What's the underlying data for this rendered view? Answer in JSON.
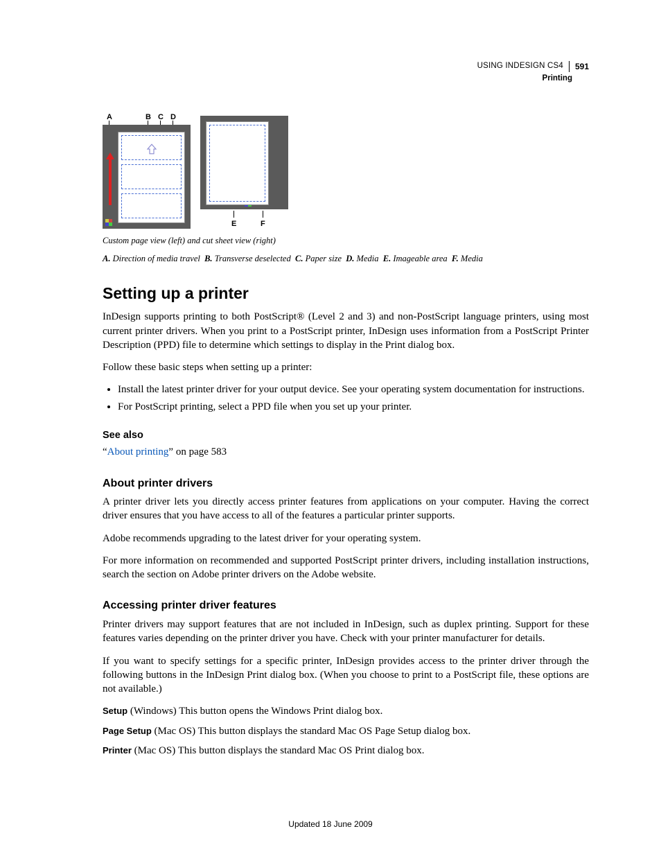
{
  "header": {
    "title": "USING INDESIGN CS4",
    "section": "Printing",
    "page": "591"
  },
  "figure": {
    "top_labels": {
      "A": "A",
      "B": "B",
      "C": "C",
      "D": "D"
    },
    "bottom_labels": {
      "E": "E",
      "F": "F"
    },
    "caption_title": "Custom page view (left) and cut sheet view (right)",
    "key": {
      "A": {
        "letter": "A.",
        "text": "Direction of media travel"
      },
      "B": {
        "letter": "B.",
        "text": "Transverse deselected"
      },
      "C": {
        "letter": "C.",
        "text": "Paper size"
      },
      "D": {
        "letter": "D.",
        "text": "Media"
      },
      "E": {
        "letter": "E.",
        "text": "Imageable area"
      },
      "F": {
        "letter": "F.",
        "text": "Media"
      }
    }
  },
  "h1": "Setting up a printer",
  "para1": "InDesign supports printing to both PostScript® (Level 2 and 3) and non-PostScript language printers, using most current printer drivers. When you print to a PostScript printer, InDesign uses information from a PostScript Printer Description (PPD) file to determine which settings to display in the Print dialog box.",
  "para2": "Follow these basic steps when setting up a printer:",
  "bullets": [
    "Install the latest printer driver for your output device. See your operating system documentation for instructions.",
    "For PostScript printing, select a PPD file when you set up your printer."
  ],
  "see_also": {
    "heading": "See also",
    "q1": "“",
    "link": "About printing",
    "rest": "” on page 583"
  },
  "h3a": "About printer drivers",
  "para3": "A printer driver lets you directly access printer features from applications on your computer. Having the correct driver ensures that you have access to all of the features a particular printer supports.",
  "para4": "Adobe recommends upgrading to the latest driver for your operating system.",
  "para5": "For more information on recommended and supported PostScript printer drivers, including installation instructions, search the section on Adobe printer drivers on the Adobe website.",
  "h3b": "Accessing printer driver features",
  "para6": "Printer drivers may support features that are not included in InDesign, such as duplex printing. Support for these features varies depending on the printer driver you have. Check with your printer manufacturer for details.",
  "para7": "If you want to specify settings for a specific printer, InDesign provides access to the printer driver through the following buttons in the InDesign Print dialog box. (When you choose to print to a PostScript file, these options are not available.)",
  "defs": [
    {
      "term": "Setup",
      "desc": " (Windows) This button opens the Windows Print dialog box."
    },
    {
      "term": "Page Setup",
      "desc": " (Mac OS) This button displays the standard Mac OS Page Setup dialog box."
    },
    {
      "term": "Printer",
      "desc": " (Mac OS) This button displays the standard Mac OS Print dialog box."
    }
  ],
  "footer": "Updated 18 June 2009"
}
